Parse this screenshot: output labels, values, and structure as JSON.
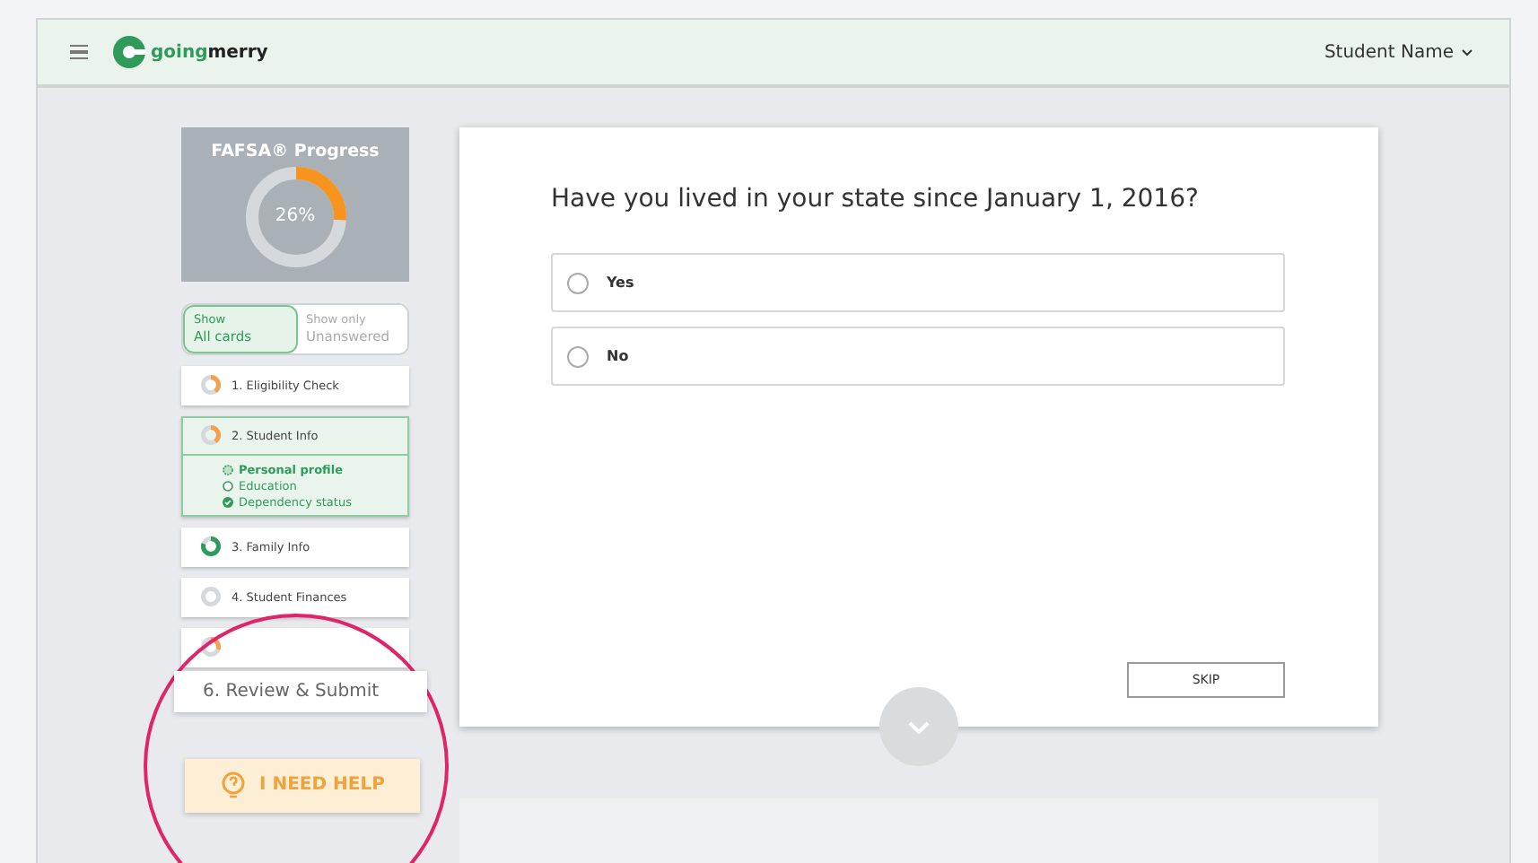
{
  "header": {
    "logo_text_light": "going",
    "logo_text_bold": "merry",
    "user_menu": "Student Name"
  },
  "progress": {
    "title": "FAFSA® Progress",
    "level": 0.26,
    "reading": "26%"
  },
  "filter": [
    {
      "line1": "Show",
      "line2": "All cards",
      "selected": true
    },
    {
      "line1": "Show only",
      "line2": "Unanswered",
      "selected": false
    }
  ],
  "steps": [
    {
      "kind": "card",
      "label": "1. Eligibility Check",
      "level": 0.4,
      "color": "#f5a04a",
      "expanded": false
    },
    {
      "kind": "card",
      "label": "2. Student Info",
      "level": 0.4,
      "color": "#f5a04a",
      "expanded": true,
      "children": [
        {
          "label": "Personal profile",
          "kind": "current"
        },
        {
          "label": "Education",
          "kind": "todo"
        },
        {
          "label": "Dependency status",
          "kind": "done"
        }
      ]
    },
    {
      "kind": "card",
      "label": "3. Family Info",
      "level": 0.8,
      "color": "#2e9b5b",
      "expanded": false
    },
    {
      "kind": "card",
      "label": "4. Student Finances",
      "expanded": false
    },
    {
      "kind": "card",
      "level": 0.3,
      "color": "#f5a04a",
      "expanded": false
    },
    {
      "kind": "zoomed",
      "label": "6. Review & Submit"
    }
  ],
  "help_button": "I NEED HELP",
  "question": {
    "text": "Have you lived in your state since January 1, 2016?",
    "options": [
      {
        "label": "Yes",
        "selected": false
      },
      {
        "label": "No",
        "selected": false
      }
    ],
    "skip": "SKIP"
  }
}
